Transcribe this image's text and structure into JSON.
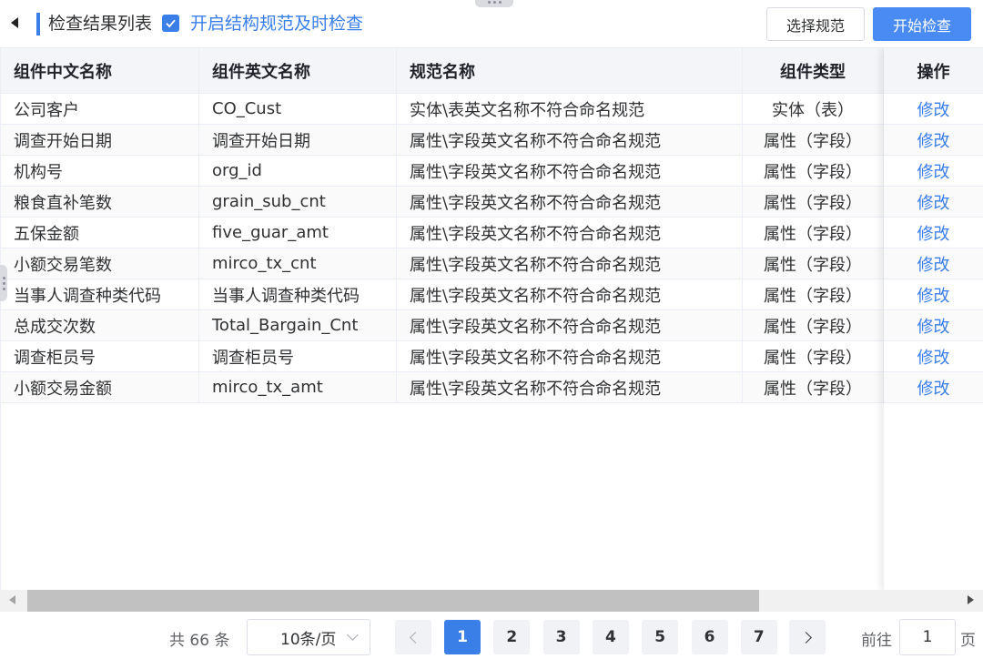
{
  "toolbar": {
    "title": "检查结果列表",
    "checkbox_checked": true,
    "checkbox_label": "开启结构规范及时检查",
    "select_button": "选择规范",
    "start_button": "开始检查",
    "accent_color": "#3a7ee8"
  },
  "table": {
    "columns": [
      "组件中文名称",
      "组件英文名称",
      "规范名称",
      "组件类型",
      "操作"
    ],
    "rows": [
      {
        "cn": "公司客户",
        "en": "CO_Cust",
        "rule": "实体\\表英文名称不符合命名规范",
        "type": "实体（表）",
        "action": "修改"
      },
      {
        "cn": "调查开始日期",
        "en": "调查开始日期",
        "rule": "属性\\字段英文名称不符合命名规范",
        "type": "属性（字段）",
        "action": "修改"
      },
      {
        "cn": "机构号",
        "en": "org_id",
        "rule": "属性\\字段英文名称不符合命名规范",
        "type": "属性（字段）",
        "action": "修改"
      },
      {
        "cn": "粮食直补笔数",
        "en": "grain_sub_cnt",
        "rule": "属性\\字段英文名称不符合命名规范",
        "type": "属性（字段）",
        "action": "修改"
      },
      {
        "cn": "五保金额",
        "en": "five_guar_amt",
        "rule": "属性\\字段英文名称不符合命名规范",
        "type": "属性（字段）",
        "action": "修改"
      },
      {
        "cn": "小额交易笔数",
        "en": "mirco_tx_cnt",
        "rule": "属性\\字段英文名称不符合命名规范",
        "type": "属性（字段）",
        "action": "修改"
      },
      {
        "cn": "当事人调查种类代码",
        "en": "当事人调查种类代码",
        "rule": "属性\\字段英文名称不符合命名规范",
        "type": "属性（字段）",
        "action": "修改"
      },
      {
        "cn": "总成交次数",
        "en": "Total_Bargain_Cnt",
        "rule": "属性\\字段英文名称不符合命名规范",
        "type": "属性（字段）",
        "action": "修改"
      },
      {
        "cn": "调查柜员号",
        "en": "调查柜员号",
        "rule": "属性\\字段英文名称不符合命名规范",
        "type": "属性（字段）",
        "action": "修改"
      },
      {
        "cn": "小额交易金额",
        "en": "mirco_tx_amt",
        "rule": "属性\\字段英文名称不符合命名规范",
        "type": "属性（字段）",
        "action": "修改"
      }
    ]
  },
  "pagination": {
    "total_text": "共 66 条",
    "page_size": "10条/页",
    "pages": [
      "1",
      "2",
      "3",
      "4",
      "5",
      "6",
      "7"
    ],
    "current_page": "1",
    "goto_label": "前往",
    "goto_value": "1",
    "goto_suffix": "页"
  }
}
